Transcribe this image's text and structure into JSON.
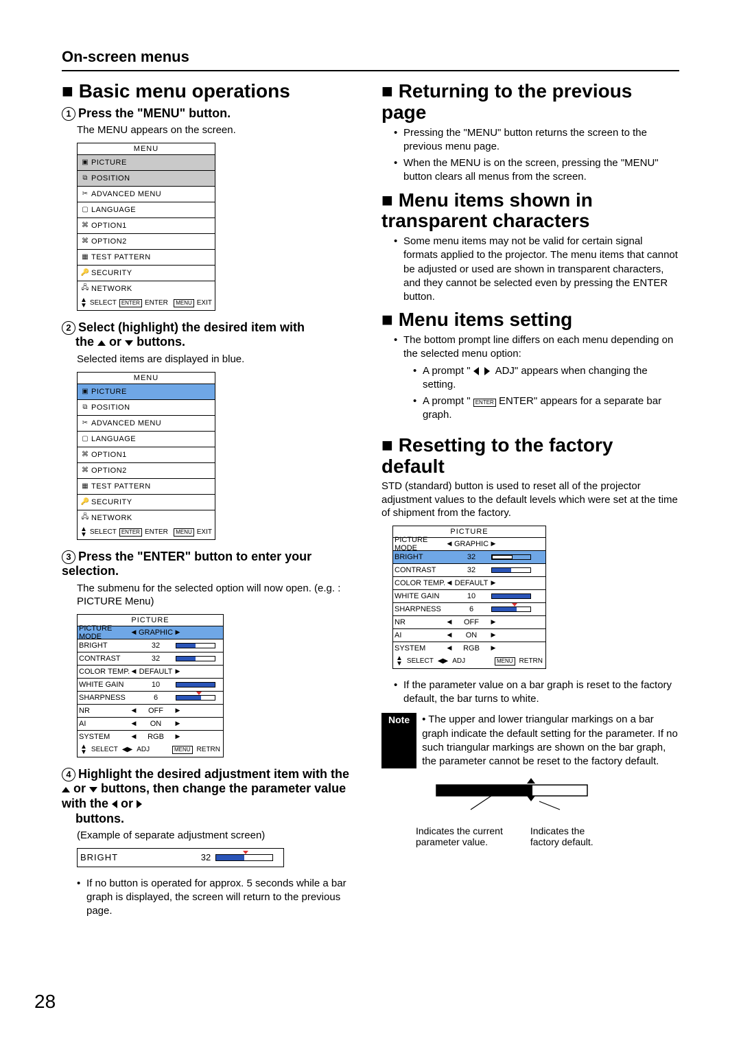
{
  "page_number": "28",
  "section": "On-screen menus",
  "left": {
    "heading": "Basic menu operations",
    "step1": {
      "title": "Press the \"MENU\" button.",
      "body": "The MENU appears on the screen.",
      "menu_title": "MENU",
      "items": [
        {
          "icon": "▣",
          "label": "PICTURE",
          "state": "shaded"
        },
        {
          "icon": "⧉",
          "label": "POSITION",
          "state": "shaded"
        },
        {
          "icon": "✂",
          "label": "ADVANCED MENU",
          "state": ""
        },
        {
          "icon": "▢",
          "label": "LANGUAGE",
          "state": ""
        },
        {
          "icon": "⌘",
          "label": "OPTION1",
          "state": ""
        },
        {
          "icon": "⌘",
          "label": "OPTION2",
          "state": ""
        },
        {
          "icon": "▦",
          "label": "TEST PATTERN",
          "state": ""
        },
        {
          "icon": "🔑",
          "label": "SECURITY",
          "state": ""
        },
        {
          "icon": "🖧",
          "label": "NETWORK",
          "state": ""
        }
      ],
      "footer_select": "SELECT",
      "footer_enter_tag": "ENTER",
      "footer_enter": "ENTER",
      "footer_menu_tag": "MENU",
      "footer_exit": "EXIT"
    },
    "step2": {
      "title_a": "Select (highlight) the desired item with",
      "title_b": "the ",
      "title_c": " or ",
      "title_d": " buttons.",
      "body": "Selected items are displayed in blue.",
      "menu_title": "MENU",
      "items": [
        {
          "icon": "▣",
          "label": "PICTURE",
          "state": "selected"
        },
        {
          "icon": "⧉",
          "label": "POSITION",
          "state": ""
        },
        {
          "icon": "✂",
          "label": "ADVANCED MENU",
          "state": ""
        },
        {
          "icon": "▢",
          "label": "LANGUAGE",
          "state": ""
        },
        {
          "icon": "⌘",
          "label": "OPTION1",
          "state": ""
        },
        {
          "icon": "⌘",
          "label": "OPTION2",
          "state": ""
        },
        {
          "icon": "▦",
          "label": "TEST PATTERN",
          "state": ""
        },
        {
          "icon": "🔑",
          "label": "SECURITY",
          "state": ""
        },
        {
          "icon": "🖧",
          "label": "NETWORK",
          "state": ""
        }
      ]
    },
    "step3": {
      "title": "Press the \"ENTER\" button to enter your selection.",
      "body": "The submenu for the selected option will now open. (e.g. : PICTURE Menu)",
      "pic_title": "PICTURE",
      "rows": [
        {
          "name": "PICTURE MODE",
          "val": "GRAPHIC",
          "arrow": true,
          "sel": true
        },
        {
          "name": "BRIGHT",
          "val": "32",
          "bar": 0.5
        },
        {
          "name": "CONTRAST",
          "val": "32",
          "bar": 0.5
        },
        {
          "name": "COLOR TEMP.",
          "val": "DEFAULT",
          "arrow": true
        },
        {
          "name": "WHITE GAIN",
          "val": "10",
          "bar": 1.0
        },
        {
          "name": "SHARPNESS",
          "val": "6",
          "bar": 0.65,
          "tri": 0.55
        },
        {
          "name": "NR",
          "val": "OFF",
          "arrow": true
        },
        {
          "name": "AI",
          "val": "ON",
          "arrow": true
        },
        {
          "name": "SYSTEM",
          "val": "RGB",
          "arrow": true
        }
      ],
      "footer_select": "SELECT",
      "footer_adj": "ADJ",
      "footer_menu_tag": "MENU",
      "footer_retrn": "RETRN"
    },
    "step4": {
      "title_a": "Highlight the desired adjustment item with the ",
      "title_b": " or ",
      "title_c": "buttons, then change the parameter value with the ",
      "title_d": " or",
      "title_e": "buttons.",
      "caption": "(Example of separate adjustment screen)",
      "sep_name": "BRIGHT",
      "sep_val": "32"
    },
    "footnote": "If no button is operated for approx. 5 seconds while a bar graph is displayed, the screen will return to the previous page."
  },
  "right": {
    "h1": "Returning to the previous page",
    "h1_b1": "Pressing the \"MENU\" button returns the screen to the previous menu page.",
    "h1_b2": "When the MENU is on the screen, pressing the \"MENU\" button clears all menus from the screen.",
    "h2": "Menu items shown in transparent characters",
    "h2_b1": "Some menu items may not be valid for certain signal formats applied to the projector. The menu items that cannot be adjusted or used are shown in transparent characters, and they cannot be selected even by pressing the ENTER button.",
    "h3": "Menu items setting",
    "h3_b1": "The bottom prompt line differs on each menu depending on the selected menu option:",
    "h3_sub1_a": "A prompt \"",
    "h3_sub1_b": "ADJ\" appears when changing the setting.",
    "h3_sub2_a": "A prompt \" ",
    "h3_sub2_tag": "ENTER",
    "h3_sub2_b": " ENTER\" appears for a separate bar graph.",
    "h4": "Resetting to the factory default",
    "h4_body": "STD (standard) button is used to reset all of the projector adjustment values to the default levels which were set at the time of shipment from the factory.",
    "pic_title": "PICTURE",
    "rows": [
      {
        "name": "PICTURE MODE",
        "val": "GRAPHIC",
        "arrow": true
      },
      {
        "name": "BRIGHT",
        "val": "32",
        "bar": 0.5,
        "sel": true,
        "white": true
      },
      {
        "name": "CONTRAST",
        "val": "32",
        "bar": 0.5
      },
      {
        "name": "COLOR TEMP.",
        "val": "DEFAULT",
        "arrow": true
      },
      {
        "name": "WHITE GAIN",
        "val": "10",
        "bar": 1.0
      },
      {
        "name": "SHARPNESS",
        "val": "6",
        "bar": 0.65,
        "tri": 0.55
      },
      {
        "name": "NR",
        "val": "OFF",
        "arrow": true
      },
      {
        "name": "AI",
        "val": "ON",
        "arrow": true
      },
      {
        "name": "SYSTEM",
        "val": "RGB",
        "arrow": true
      }
    ],
    "footer_select": "SELECT",
    "footer_adj": "ADJ",
    "footer_menu_tag": "MENU",
    "footer_retrn": "RETRN",
    "h4_b1": "If the parameter value on a bar graph is reset to the factory default, the bar turns to white.",
    "note_label": "Note",
    "note_text": "The upper and lower triangular markings on a bar graph indicate the default setting for the parameter. If no such triangular markings are shown on the bar graph, the parameter cannot be reset to the factory default.",
    "diag_left_a": "Indicates the current",
    "diag_left_b": "parameter value.",
    "diag_right_a": "Indicates the",
    "diag_right_b": "factory default."
  }
}
